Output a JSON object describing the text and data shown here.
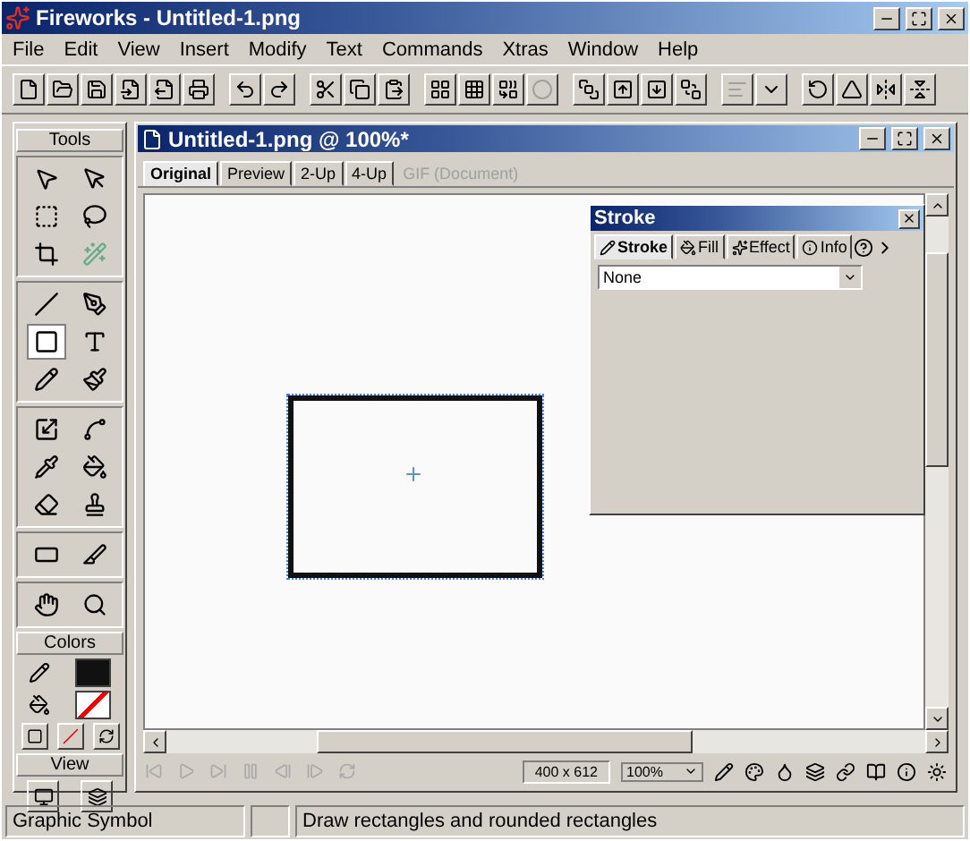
{
  "window": {
    "title": "Fireworks - Untitled-1.png"
  },
  "menu": [
    "File",
    "Edit",
    "View",
    "Insert",
    "Modify",
    "Text",
    "Commands",
    "Xtras",
    "Window",
    "Help"
  ],
  "tools_panel": {
    "title": "Tools",
    "groups": [
      [
        {
          "kind": "pointer",
          "selected": false
        },
        {
          "kind": "subselect",
          "selected": false
        },
        {
          "kind": "marquee",
          "selected": false
        },
        {
          "kind": "lasso",
          "selected": false
        },
        {
          "kind": "crop",
          "selected": false
        },
        {
          "kind": "wand",
          "selected": false
        }
      ],
      [
        {
          "kind": "line",
          "selected": false
        },
        {
          "kind": "pen",
          "selected": false
        },
        {
          "kind": "rectangle",
          "selected": true
        },
        {
          "kind": "text",
          "selected": false
        },
        {
          "kind": "pencil",
          "selected": false
        },
        {
          "kind": "brush",
          "selected": false
        }
      ],
      [
        {
          "kind": "scale",
          "selected": false
        },
        {
          "kind": "reshape",
          "selected": false
        },
        {
          "kind": "eyedropper",
          "selected": false
        },
        {
          "kind": "bucket",
          "selected": false
        },
        {
          "kind": "eraser",
          "selected": false
        },
        {
          "kind": "stamp",
          "selected": false
        }
      ],
      [
        {
          "kind": "hotspot",
          "selected": false
        },
        {
          "kind": "slice",
          "selected": false
        }
      ],
      [
        {
          "kind": "hand",
          "selected": false
        },
        {
          "kind": "zoom",
          "selected": false
        }
      ]
    ],
    "colors_label": "Colors",
    "view_label": "View"
  },
  "document": {
    "title": "Untitled-1.png @  100%*",
    "tabs": [
      {
        "label": "Original",
        "selected": true,
        "disabled": false
      },
      {
        "label": "Preview",
        "selected": false,
        "disabled": false
      },
      {
        "label": "2-Up",
        "selected": false,
        "disabled": false
      },
      {
        "label": "4-Up",
        "selected": false,
        "disabled": false
      },
      {
        "label": "GIF (Document)",
        "selected": false,
        "disabled": true
      }
    ],
    "image_size": "400 x 612",
    "zoom": "100%"
  },
  "stroke_panel": {
    "title": "Stroke",
    "tabs": [
      {
        "label": "Stroke",
        "selected": true
      },
      {
        "label": "Fill",
        "selected": false
      },
      {
        "label": "Effect",
        "selected": false
      },
      {
        "label": "Info",
        "selected": false
      }
    ],
    "stroke_type": "None"
  },
  "status_bar": {
    "selection": "Graphic Symbol",
    "hint": "Draw rectangles and rounded rectangles"
  }
}
